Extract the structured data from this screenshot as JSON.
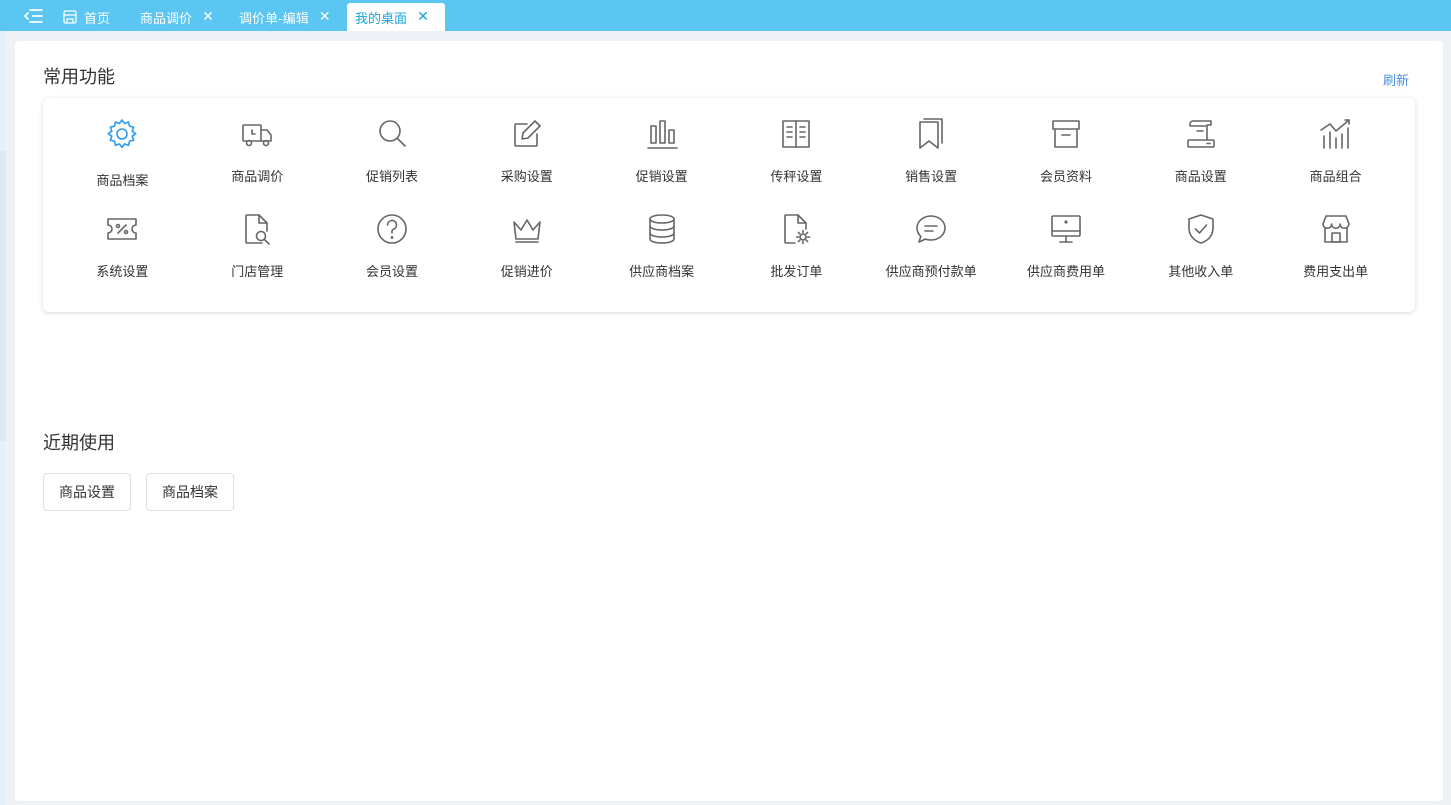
{
  "tabs": [
    {
      "label": "首页",
      "active": false,
      "closable": false,
      "icon": "store-icon"
    },
    {
      "label": "商品调价",
      "active": false,
      "closable": true
    },
    {
      "label": "调价单-编辑",
      "active": false,
      "closable": true
    },
    {
      "label": "我的桌面",
      "active": true,
      "closable": true
    }
  ],
  "close_glyph": "✕",
  "common": {
    "title": "常用功能",
    "refresh_label": "刷新",
    "items": [
      {
        "label": "商品档案",
        "icon": "gear-icon",
        "highlight": true
      },
      {
        "label": "商品调价",
        "icon": "truck-icon"
      },
      {
        "label": "促销列表",
        "icon": "search-icon"
      },
      {
        "label": "采购设置",
        "icon": "edit-icon"
      },
      {
        "label": "促销设置",
        "icon": "bar-chart-icon"
      },
      {
        "label": "传秤设置",
        "icon": "book-icon"
      },
      {
        "label": "销售设置",
        "icon": "bookmark-icon"
      },
      {
        "label": "会员资料",
        "icon": "archive-box-icon"
      },
      {
        "label": "商品设置",
        "icon": "scroll-icon"
      },
      {
        "label": "商品组合",
        "icon": "trend-chart-icon"
      },
      {
        "label": "系统设置",
        "icon": "ticket-percent-icon"
      },
      {
        "label": "门店管理",
        "icon": "file-search-icon"
      },
      {
        "label": "会员设置",
        "icon": "help-circle-icon"
      },
      {
        "label": "促销进价",
        "icon": "crown-icon"
      },
      {
        "label": "供应商档案",
        "icon": "database-icon"
      },
      {
        "label": "批发订单",
        "icon": "file-settings-icon"
      },
      {
        "label": "供应商预付款单",
        "icon": "chat-bubble-icon"
      },
      {
        "label": "供应商费用单",
        "icon": "monitor-icon"
      },
      {
        "label": "其他收入单",
        "icon": "shield-check-icon"
      },
      {
        "label": "费用支出单",
        "icon": "shop-icon"
      }
    ]
  },
  "recent": {
    "title": "近期使用",
    "items": [
      {
        "label": "商品设置"
      },
      {
        "label": "商品档案"
      }
    ]
  },
  "colors": {
    "tabbar": "#5bc6f2",
    "active_tab_text": "#1aa3dc",
    "icon_gray": "#666666",
    "icon_highlight": "#2d9cf0",
    "link": "#4a90e2"
  }
}
